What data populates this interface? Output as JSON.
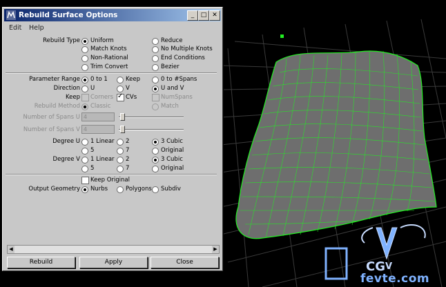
{
  "window": {
    "title": "Rebuild Surface Options",
    "min": "_",
    "max": "□",
    "close": "✕"
  },
  "menu": {
    "edit": "Edit",
    "help": "Help"
  },
  "rebuild_type": {
    "label": "Rebuild Type",
    "options": [
      "Uniform",
      "Reduce",
      "Match Knots",
      "No Multiple Knots",
      "Non-Rational",
      "End Conditions",
      "Trim Convert",
      "Bezier"
    ],
    "selected": "Uniform"
  },
  "parameter_range": {
    "label": "Parameter Range",
    "options": [
      "0 to 1",
      "Keep",
      "0 to #Spans"
    ],
    "selected": "0 to 1"
  },
  "direction": {
    "label": "Direction",
    "options": [
      "U",
      "V",
      "U and V"
    ],
    "selected": "U and V"
  },
  "keep": {
    "label": "Keep",
    "corners": "Corners",
    "cvs": "CVs",
    "numspans": "NumSpans"
  },
  "rebuild_method": {
    "label": "Rebuild Method",
    "classic": "Classic",
    "match": "Match"
  },
  "spans_u": {
    "label": "Number of Spans U",
    "value": "4"
  },
  "spans_v": {
    "label": "Number of Spans V",
    "value": "4"
  },
  "degree_u": {
    "label": "Degree U",
    "options": [
      "1 Linear",
      "2",
      "3 Cubic",
      "5",
      "7",
      "Original"
    ],
    "selected": "3 Cubic"
  },
  "degree_v": {
    "label": "Degree V",
    "options": [
      "1 Linear",
      "2",
      "3 Cubic",
      "5",
      "7",
      "Original"
    ],
    "selected": "3 Cubic"
  },
  "keep_original": {
    "label": "Keep Original",
    "checked": false
  },
  "output_geometry": {
    "label": "Output Geometry",
    "options": [
      "Nurbs",
      "Polygons",
      "Subdiv"
    ],
    "selected": "Nurbs"
  },
  "buttons": {
    "rebuild": "Rebuild",
    "apply": "Apply",
    "close": "Close"
  },
  "watermark": {
    "text": "fevte.com"
  },
  "colors": {
    "wire": "#22ee22",
    "titlebar": "#0a246a",
    "dialog": "#c8c8c8"
  }
}
